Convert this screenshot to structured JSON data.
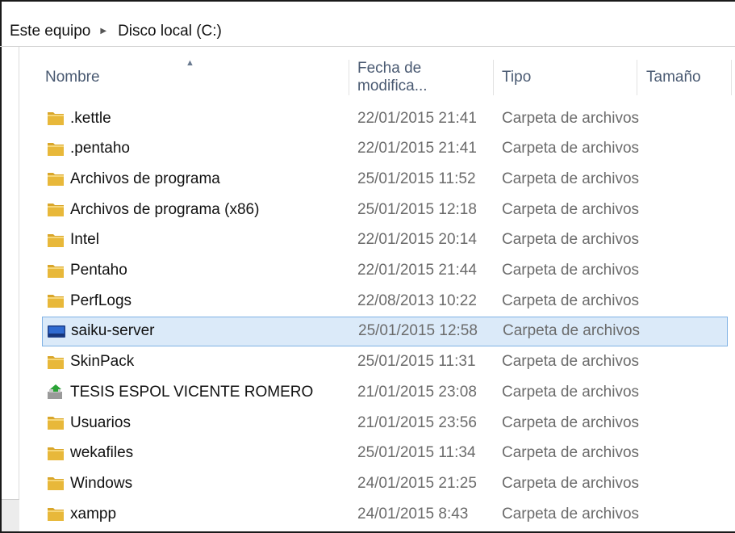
{
  "breadcrumb": {
    "items": [
      "Este equipo",
      "Disco local (C:)"
    ],
    "separator_icon": "chevron-right-icon"
  },
  "columns": {
    "name": "Nombre",
    "date": "Fecha de modifica...",
    "type": "Tipo",
    "size": "Tamaño",
    "sorted_by": "Nombre",
    "sort_indicator": "up-caret-icon"
  },
  "colors": {
    "selection_bg": "#dbeaf9",
    "selection_border": "#7fb1e4",
    "header_text": "#4a5a72",
    "folder_yellow": "#e8b83a"
  },
  "files": [
    {
      "name": ".kettle",
      "date": "22/01/2015 21:41",
      "type": "Carpeta de archivos",
      "icon": "folder-icon"
    },
    {
      "name": ".pentaho",
      "date": "22/01/2015 21:41",
      "type": "Carpeta de archivos",
      "icon": "folder-icon"
    },
    {
      "name": "Archivos de programa",
      "date": "25/01/2015 11:52",
      "type": "Carpeta de archivos",
      "icon": "folder-icon"
    },
    {
      "name": "Archivos de programa (x86)",
      "date": "25/01/2015 12:18",
      "type": "Carpeta de archivos",
      "icon": "folder-icon"
    },
    {
      "name": "Intel",
      "date": "22/01/2015 20:14",
      "type": "Carpeta de archivos",
      "icon": "folder-icon"
    },
    {
      "name": "Pentaho",
      "date": "22/01/2015 21:44",
      "type": "Carpeta de archivos",
      "icon": "folder-icon"
    },
    {
      "name": "PerfLogs",
      "date": "22/08/2013 10:22",
      "type": "Carpeta de archivos",
      "icon": "folder-icon"
    },
    {
      "name": "saiku-server",
      "date": "25/01/2015 12:58",
      "type": "Carpeta de archivos",
      "icon": "desktop-folder-icon",
      "selected": true
    },
    {
      "name": "SkinPack",
      "date": "25/01/2015 11:31",
      "type": "Carpeta de archivos",
      "icon": "folder-icon"
    },
    {
      "name": "TESIS ESPOL VICENTE ROMERO",
      "date": "21/01/2015 23:08",
      "type": "Carpeta de archivos",
      "icon": "shared-folder-icon"
    },
    {
      "name": "Usuarios",
      "date": "21/01/2015 23:56",
      "type": "Carpeta de archivos",
      "icon": "folder-icon"
    },
    {
      "name": "wekafiles",
      "date": "25/01/2015 11:34",
      "type": "Carpeta de archivos",
      "icon": "folder-icon"
    },
    {
      "name": "Windows",
      "date": "24/01/2015 21:25",
      "type": "Carpeta de archivos",
      "icon": "folder-icon"
    },
    {
      "name": "xampp",
      "date": "24/01/2015 8:43",
      "type": "Carpeta de archivos",
      "icon": "folder-icon"
    }
  ]
}
